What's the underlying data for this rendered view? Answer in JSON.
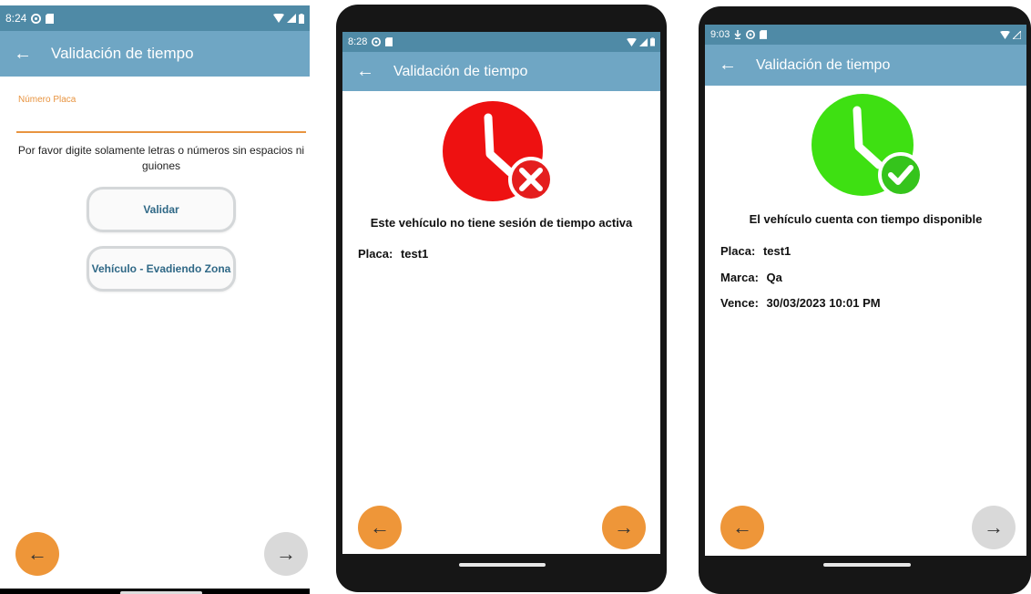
{
  "phone1": {
    "status_time": "8:24",
    "title": "Validación de tiempo",
    "field_label": "Número Placa",
    "field_value": "",
    "help_text": "Por favor digite solamente letras o números sin espacios ni guiones",
    "validar_label": "Validar",
    "evadiendo_label": "Vehículo - Evadiendo Zona"
  },
  "phone2": {
    "status_time": "8:28",
    "title": "Validación de tiempo",
    "message": "Este vehículo no tiene sesión de tiempo activa",
    "placa_label": "Placa:",
    "placa_value": "test1"
  },
  "phone3": {
    "status_time": "9:03",
    "title": "Validación de tiempo",
    "message": "El vehículo cuenta con tiempo disponible",
    "placa_label": "Placa:",
    "placa_value": "test1",
    "marca_label": "Marca:",
    "marca_value": "Qa",
    "vence_label": "Vence:",
    "vence_value": "30/03/2023 10:01 PM"
  },
  "icons": {
    "back": "←",
    "next": "→"
  },
  "colors": {
    "appbar": "#6fa6c4",
    "statusbar": "#4f8aa6",
    "orange": "#ee9639",
    "error_red": "#ee1111",
    "success_green": "#3ee012"
  }
}
